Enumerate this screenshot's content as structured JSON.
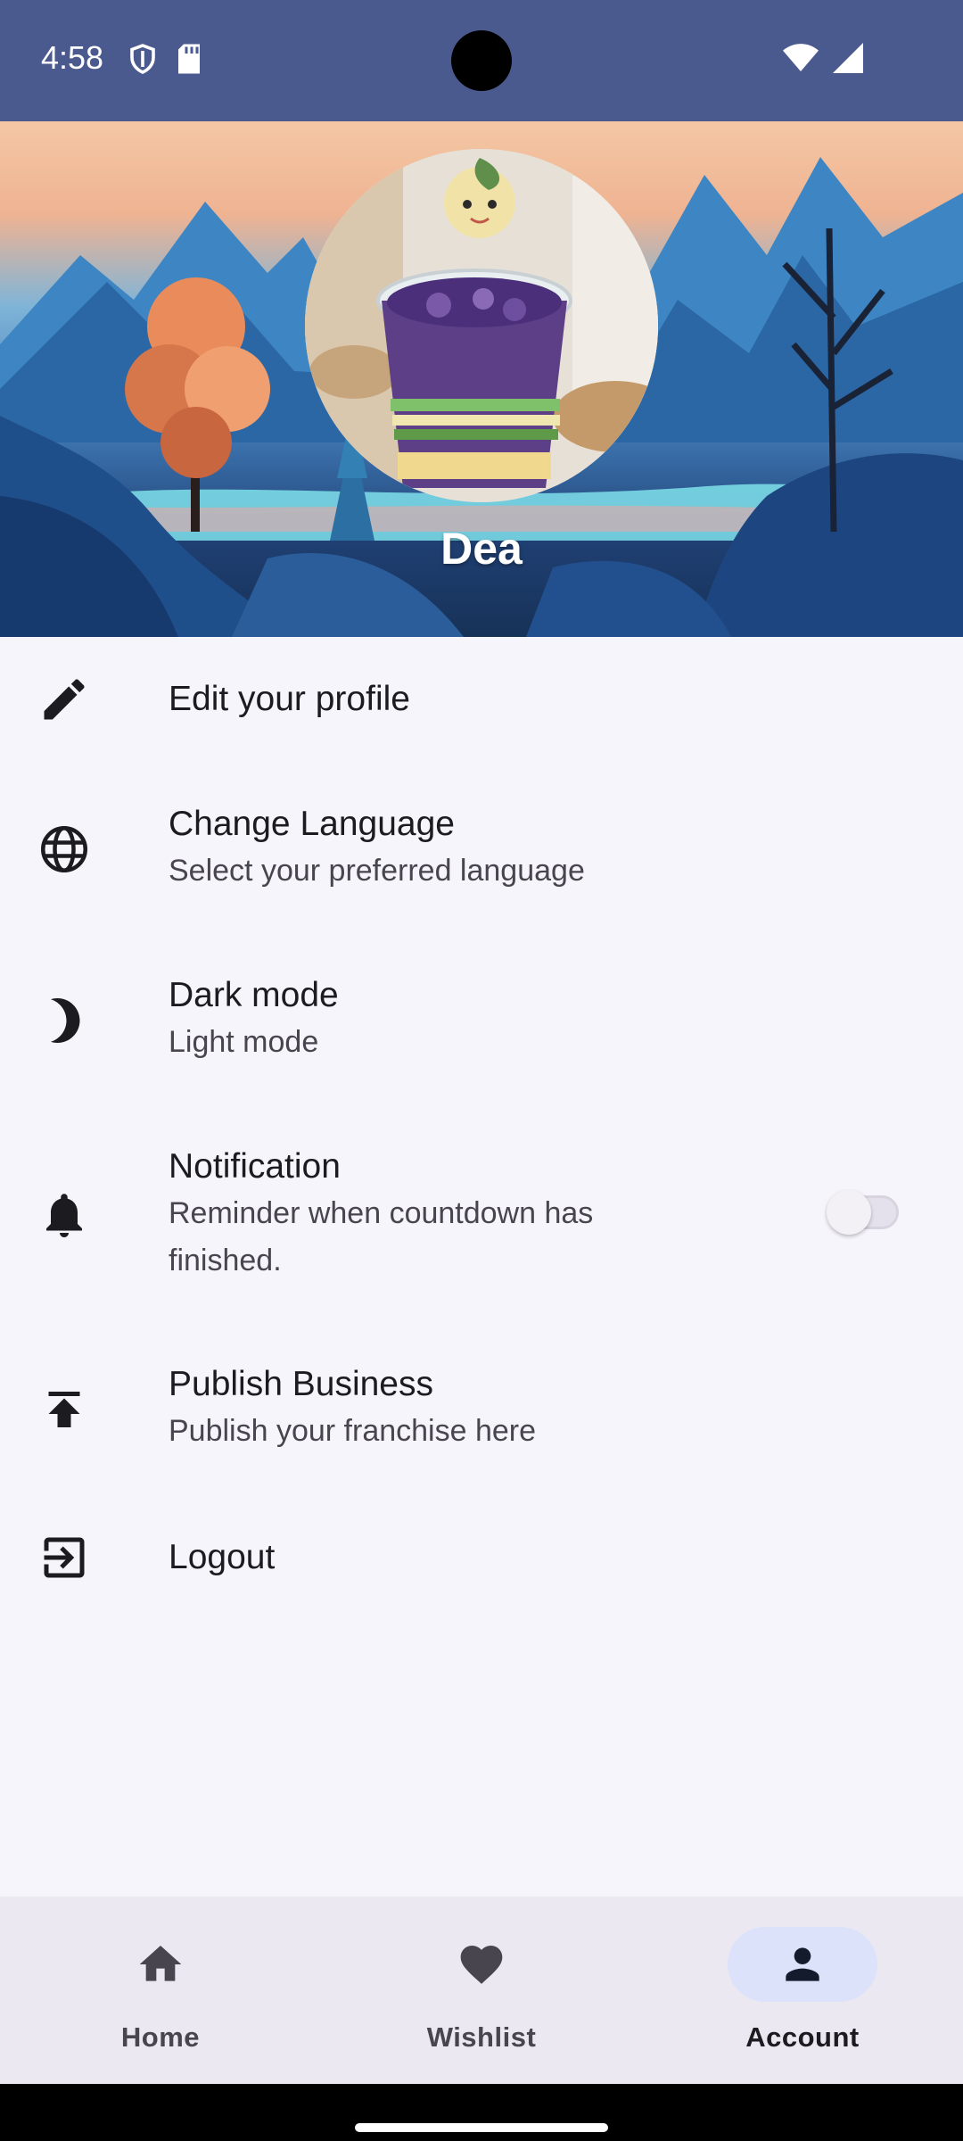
{
  "status_bar": {
    "time": "4:58",
    "left_icons": [
      "shield-icon",
      "sd-card-icon"
    ],
    "right_icons": [
      "wifi-icon",
      "signal-icon"
    ],
    "background": "#4a5a8f"
  },
  "profile": {
    "name": "Dea"
  },
  "menu": {
    "edit_profile": {
      "title": "Edit your profile",
      "icon": "pencil-icon"
    },
    "language": {
      "title": "Change Language",
      "subtitle": "Select your preferred language",
      "icon": "globe-icon"
    },
    "dark_mode": {
      "title": "Dark mode",
      "subtitle": "Light mode",
      "icon": "moon-icon"
    },
    "notification": {
      "title": "Notification",
      "subtitle_line1": "Reminder when countdown has",
      "subtitle_line2": "finished.",
      "icon": "bell-icon",
      "toggle_on": false
    },
    "publish": {
      "title": "Publish Business",
      "subtitle": "Publish your franchise here",
      "icon": "publish-icon"
    },
    "logout": {
      "title": "Logout",
      "icon": "logout-icon"
    }
  },
  "bottom_nav": {
    "items": [
      {
        "label": "Home",
        "icon": "home-icon",
        "active": false
      },
      {
        "label": "Wishlist",
        "icon": "heart-icon",
        "active": false
      },
      {
        "label": "Account",
        "icon": "person-icon",
        "active": true
      }
    ],
    "active_color": "#dbe2fa"
  }
}
